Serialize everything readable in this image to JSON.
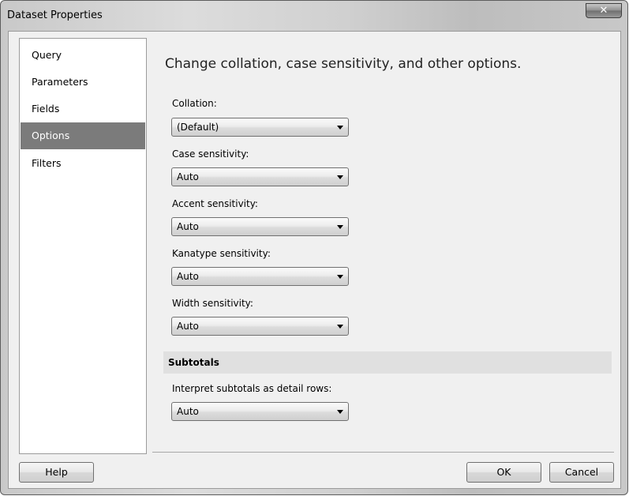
{
  "window": {
    "title": "Dataset Properties",
    "close_glyph": "✕"
  },
  "nav": {
    "items": [
      {
        "label": "Query"
      },
      {
        "label": "Parameters"
      },
      {
        "label": "Fields"
      },
      {
        "label": "Options",
        "selected": true
      },
      {
        "label": "Filters"
      }
    ]
  },
  "main": {
    "heading": "Change collation, case sensitivity, and other options.",
    "fields": [
      {
        "label": "Collation:",
        "value": "(Default)"
      },
      {
        "label": "Case sensitivity:",
        "value": "Auto"
      },
      {
        "label": "Accent sensitivity:",
        "value": "Auto"
      },
      {
        "label": "Kanatype sensitivity:",
        "value": "Auto"
      },
      {
        "label": "Width sensitivity:",
        "value": "Auto"
      }
    ],
    "subtotals": {
      "section_title": "Subtotals",
      "label": "Interpret subtotals as detail rows:",
      "value": "Auto"
    }
  },
  "footer": {
    "help": "Help",
    "ok": "OK",
    "cancel": "Cancel"
  },
  "colors": {
    "selected_nav_bg": "#7b7b7b",
    "section_bar_bg": "#e0e0e0"
  },
  "icons": {
    "close": "close-icon",
    "dropdown": "chevron-down-icon"
  }
}
